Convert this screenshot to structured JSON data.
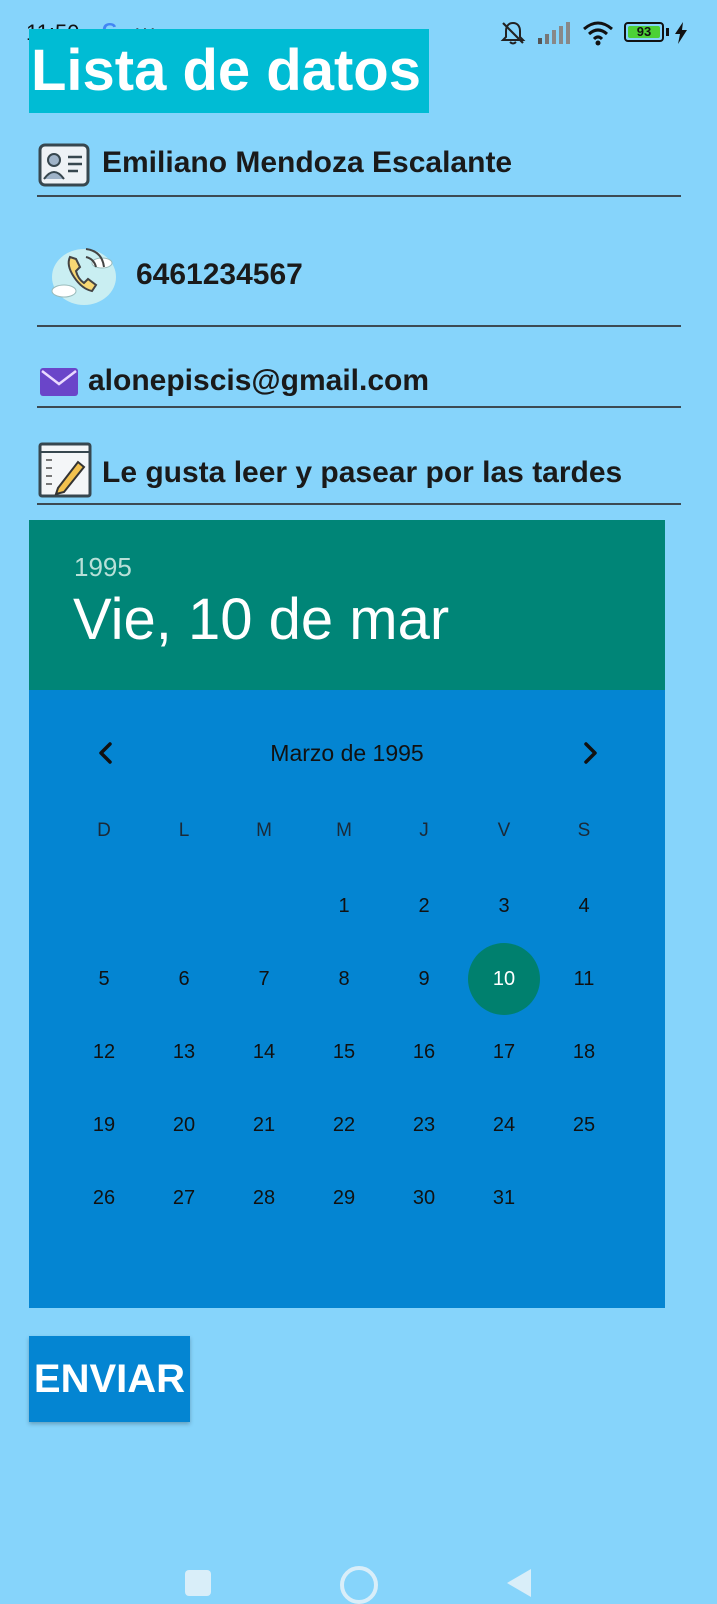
{
  "status_bar": {
    "time": "11:50",
    "google_glyph": "G",
    "dots": "···",
    "battery": "93"
  },
  "title": "Lista de datos",
  "fields": {
    "name": "Emiliano Mendoza Escalante",
    "phone": "6461234567",
    "email": "alonepiscis@gmail.com",
    "notes": "Le gusta leer y pasear por las tardes"
  },
  "icons": {
    "name": "id-card-icon",
    "phone": "phone-icon",
    "email": "envelope-icon",
    "notes": "notepad-icon"
  },
  "colors": {
    "background": "#86d4fb",
    "title_bg": "#00bcd4",
    "calendar_header": "#008577",
    "calendar_body": "#0485d2",
    "selected_day": "#00806e",
    "button_bg": "#0485d2"
  },
  "calendar": {
    "year": "1995",
    "selected_label": "Vie, 10 de mar",
    "month_label": "Marzo de 1995",
    "weekdays": [
      "D",
      "L",
      "M",
      "M",
      "J",
      "V",
      "S"
    ],
    "first_weekday_index": 3,
    "days_in_month": 31,
    "selected_day": 10
  },
  "button": {
    "label": "ENVIAR"
  }
}
